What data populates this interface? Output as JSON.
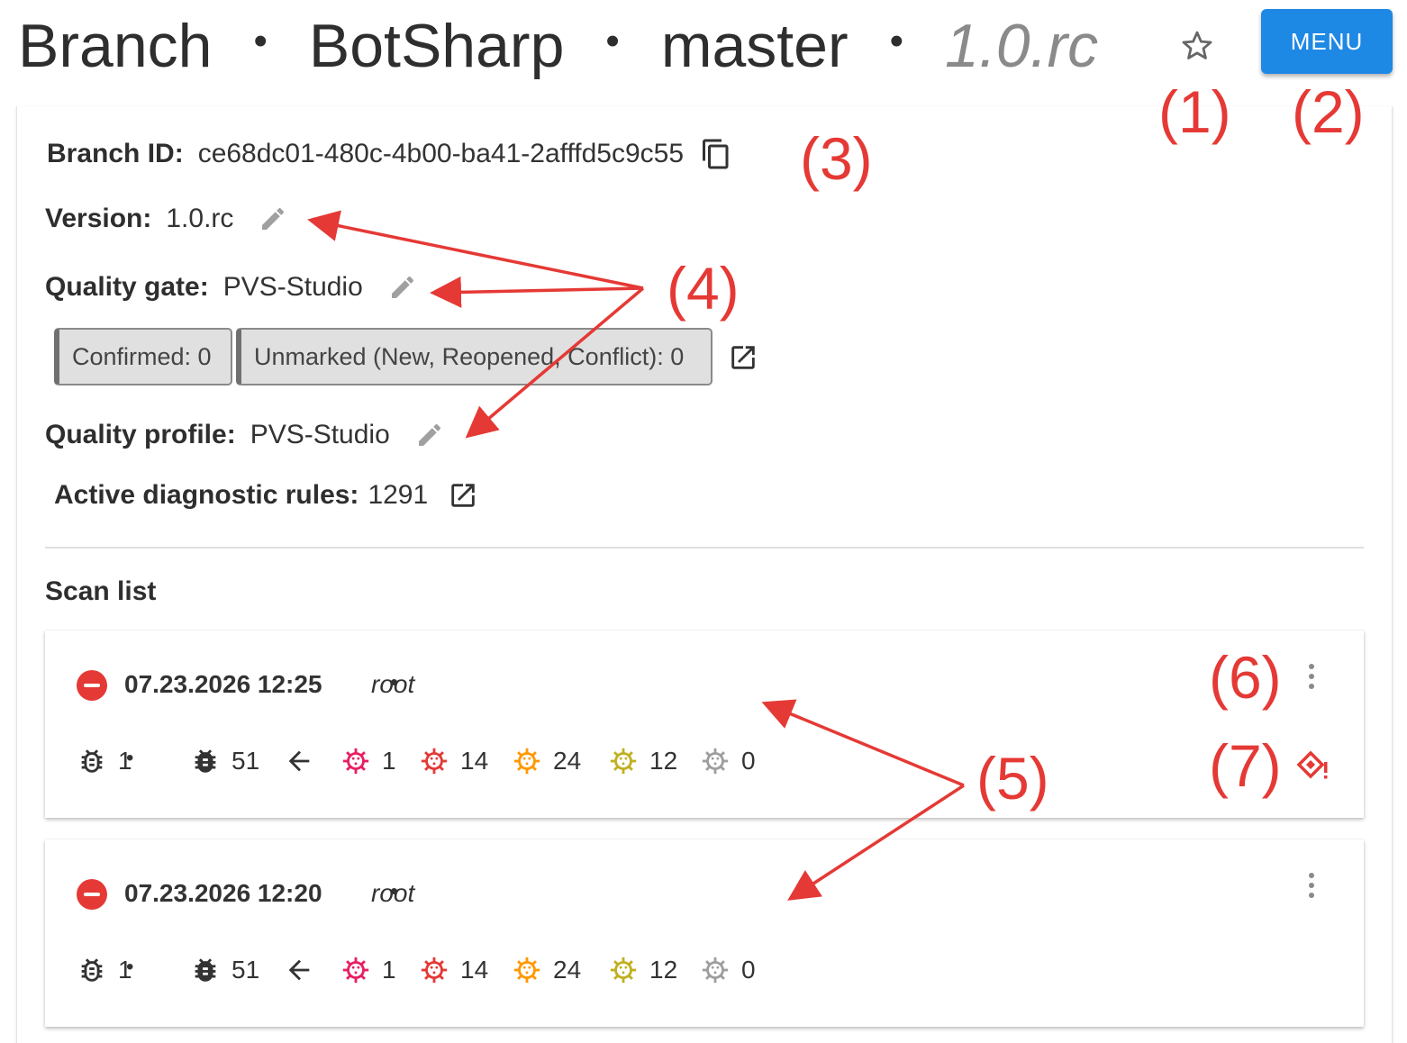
{
  "header": {
    "title_prefix": "Branch",
    "project": "BotSharp",
    "branch": "master",
    "version": "1.0.rc",
    "separator": "•",
    "favorite_icon": "star-outline-icon",
    "menu_label": "MENU"
  },
  "colors": {
    "accent": "#1e88e5",
    "annotation": "#e53935",
    "status_error": "#e53935"
  },
  "details": {
    "branch_id_label": "Branch ID:",
    "branch_id": "ce68dc01-480c-4b00-ba41-2afffd5c9c55",
    "version_label": "Version:",
    "version": "1.0.rc",
    "quality_gate_label": "Quality gate:",
    "quality_gate": "PVS-Studio",
    "chips": [
      "Confirmed: 0",
      "Unmarked (New, Reopened, Conflict): 0"
    ],
    "quality_profile_label": "Quality profile:",
    "quality_profile": "PVS-Studio",
    "rules_label": "Active diagnostic rules:",
    "rules_count": "1291"
  },
  "scan_list": {
    "title": "Scan list",
    "separator": "•",
    "scans": [
      {
        "date": "07.23.2026 12:25",
        "user": "root",
        "stats": {
          "bugs": "1",
          "total": "51",
          "critical": "1",
          "high": "14",
          "medium": "24",
          "low": "12",
          "info": "0"
        },
        "has_warning": true
      },
      {
        "date": "07.23.2026 12:20",
        "user": "root",
        "stats": {
          "bugs": "1",
          "total": "51",
          "critical": "1",
          "high": "14",
          "medium": "24",
          "low": "12",
          "info": "0"
        },
        "has_warning": false
      }
    ],
    "severity_colors": {
      "critical": "#e91e63",
      "high": "#e53935",
      "medium": "#ff9800",
      "low": "#c0b020",
      "info": "#9e9e9e"
    }
  },
  "annotations": [
    "(1)",
    "(2)",
    "(3)",
    "(4)",
    "(5)",
    "(6)",
    "(7)"
  ]
}
